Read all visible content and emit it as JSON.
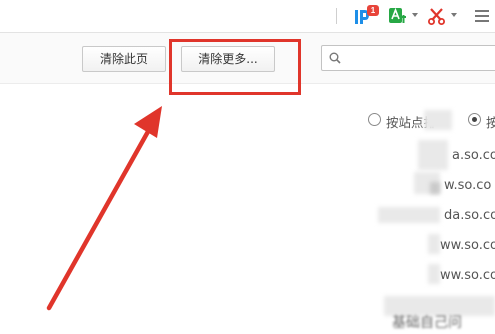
{
  "toolbar": {
    "badge_count": "1",
    "icons": [
      "ip-assistant-icon",
      "translate-icon",
      "scissors-icon"
    ]
  },
  "actions": {
    "clear_page_label": "清除此页",
    "clear_more_label": "清除更多..."
  },
  "search": {
    "placeholder": ""
  },
  "sort": {
    "by_site_label": "按站点排",
    "other_label": "按"
  },
  "sites": [
    "a.so.co",
    "w.so.co",
    "da.so.co",
    "ww.so.co",
    "ww.so.co"
  ],
  "bottom_text": "基础自己问"
}
